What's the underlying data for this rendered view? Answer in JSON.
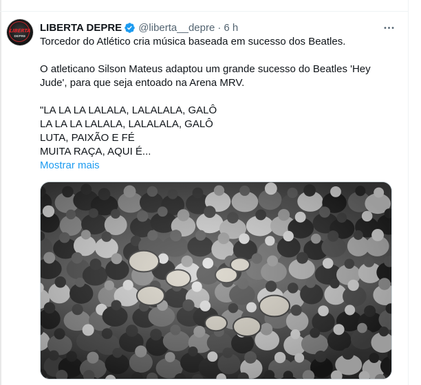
{
  "tweet": {
    "author_name": "LIBERTA DEPRE",
    "handle": "@liberta__depre",
    "separator": "·",
    "time": "6 h",
    "avatar_text": "LIBERTA",
    "avatar_subtext": "DEPRE",
    "lines": [
      "Torcedor do Atlético cria música baseada em sucesso dos Beatles.",
      "O atleticano Silson Mateus adaptou um grande sucesso do Beatles 'Hey",
      "Jude', para que seja entoado na Arena MRV.",
      "\"LA LA LA LALALA, LALALALA, GALÔ",
      "LA LA LA LALALA, LALALALA, GALÔ",
      "LUTA, PAIXÃO E FÉ",
      "MUITA RAÇA, AQUI É..."
    ],
    "show_more": "Mostrar mais",
    "photo_alt": "photo-of-fans-with-drums"
  },
  "icons": {
    "verified": "verified-badge-icon",
    "more": "more-options-icon"
  },
  "colors": {
    "link": "#1d9bf0",
    "secondary": "#536471",
    "text": "#0f1419",
    "verified": "#1d9bf0",
    "brand_red": "#e0252b"
  }
}
